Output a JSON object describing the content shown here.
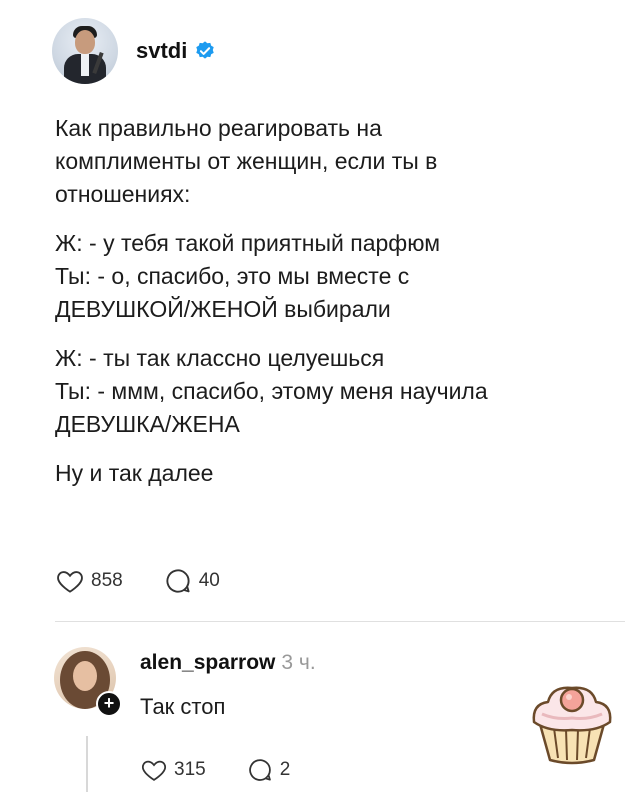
{
  "post": {
    "author": "svtdi",
    "paragraphs": [
      "Как правильно реагировать на\nкомплименты от женщин, если ты в\nотношениях:",
      "Ж: - у тебя такой приятный парфюм\nТы: - о, спасибо, это мы вместе с\nДЕВУШКОЙ/ЖЕНОЙ выбирали",
      "Ж: - ты так классно целуешься\nТы: - ммм, спасибо, этому меня научила\nДЕВУШКА/ЖЕНА",
      "Ну и так далее"
    ],
    "likes": "858",
    "comments": "40"
  },
  "reply": {
    "author": "alen_sparrow",
    "time": "3 ч.",
    "text": "Так стоп",
    "likes": "315",
    "comments": "2",
    "follow_badge": "+"
  },
  "colors": {
    "verified": "#1d9bf0",
    "divider": "#e0e0e0"
  },
  "icons": [
    "verified-icon",
    "heart-icon",
    "comment-icon",
    "cupcake-sticker"
  ]
}
